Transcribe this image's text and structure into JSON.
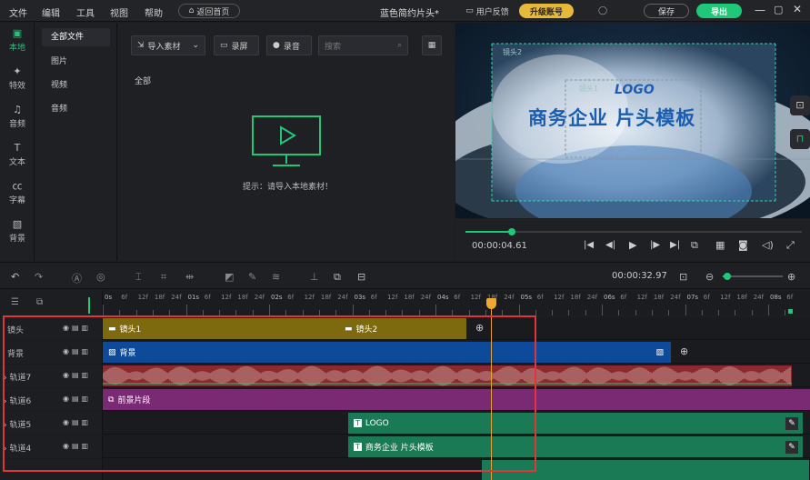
{
  "menu": {
    "file": "文件",
    "edit": "编辑",
    "tools": "工具",
    "view": "视图",
    "help": "帮助",
    "home": "返回首页"
  },
  "project": {
    "title": "蓝色简约片头*"
  },
  "header": {
    "feedback": "用户反馈",
    "upgrade": "升级账号",
    "save": "保存",
    "export": "导出"
  },
  "leftnav": [
    {
      "label": "本地",
      "icon": "folder-icon"
    },
    {
      "label": "特效",
      "icon": "effects-icon"
    },
    {
      "label": "音频",
      "icon": "music-icon"
    },
    {
      "label": "文本",
      "icon": "text-icon"
    },
    {
      "label": "字幕",
      "icon": "subtitle-icon"
    },
    {
      "label": "背景",
      "icon": "background-icon"
    }
  ],
  "subnav": [
    "全部文件",
    "图片",
    "视频",
    "音频"
  ],
  "media": {
    "import": "导入素材",
    "record_screen": "录屏",
    "record_audio": "录音",
    "search_placeholder": "搜索",
    "section": "全部",
    "empty_hint": "提示：请导入本地素材！"
  },
  "preview": {
    "logo": "LOGO",
    "headline": "商务企业 片头模板",
    "lens1": "镜头1",
    "lens2": "镜头2",
    "timecode": "00:00:04.61"
  },
  "timeline": {
    "total_time": "00:00:32.97",
    "ruler_labels": [
      "0s",
      "6f",
      "12f",
      "18f",
      "24f",
      "01s",
      "6f",
      "12f",
      "18f",
      "24f",
      "02s",
      "6f",
      "12f",
      "18f",
      "24f",
      "03s",
      "6f",
      "12f",
      "18f",
      "24f",
      "04s",
      "6f",
      "12f",
      "18f",
      "24f",
      "05s",
      "6f",
      "12f",
      "18f",
      "24f",
      "06s",
      "6f",
      "12f",
      "18f",
      "24f",
      "07s",
      "6f",
      "12f",
      "18f",
      "24f",
      "08s",
      "6f"
    ],
    "tracks": [
      {
        "name": "镜头",
        "clips": [
          {
            "label": "镜头1"
          },
          {
            "label": "镜头2"
          }
        ]
      },
      {
        "name": "背景",
        "clips": [
          {
            "label": "背景"
          }
        ]
      },
      {
        "name": "轨道7",
        "clips": [
          {
            "label": ""
          }
        ]
      },
      {
        "name": "轨道6",
        "clips": [
          {
            "label": "前景片段"
          }
        ]
      },
      {
        "name": "轨道5",
        "clips": [
          {
            "label": "LOGO"
          }
        ]
      },
      {
        "name": "轨道4",
        "clips": [
          {
            "label": "商务企业 片头模板"
          }
        ]
      }
    ]
  },
  "colors": {
    "accent": "#1ec878",
    "lens": "#7d6a0f",
    "background": "#0d4a9a",
    "audio": "#8a2a30",
    "foreground": "#7a2a73",
    "text": "#1a7a55"
  }
}
